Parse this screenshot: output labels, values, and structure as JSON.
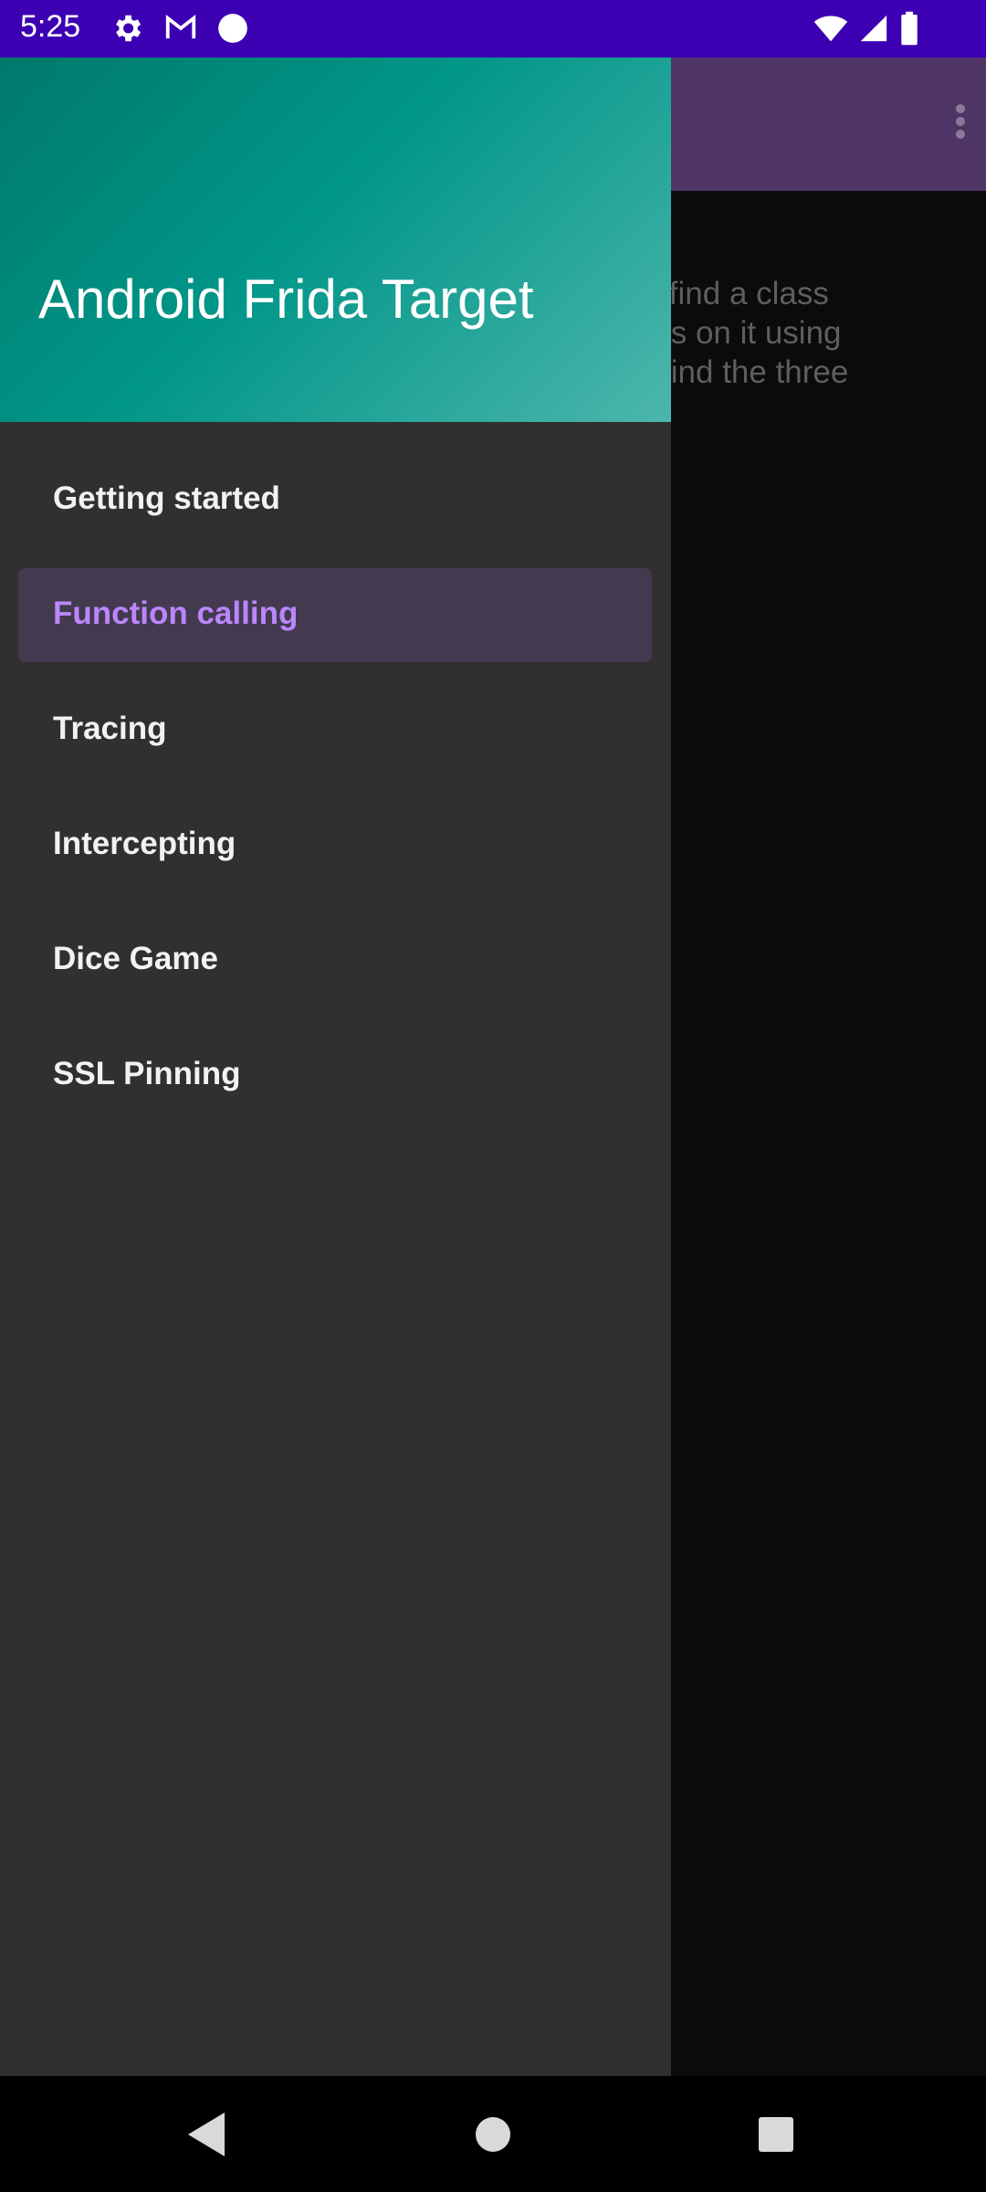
{
  "status_bar": {
    "time": "5:25",
    "left_icons": [
      "gear-icon",
      "gmail-icon",
      "circle-notification-icon"
    ],
    "right_icons": [
      "wifi-icon",
      "cell-signal-icon",
      "battery-icon"
    ],
    "background_color": "#3c00b2"
  },
  "app": {
    "toolbar_color": "#4e3566",
    "content_text": "an you find a class\nmethods on it using\nage to find the three"
  },
  "drawer": {
    "title": "Android Frida Target",
    "items": [
      {
        "label": "Getting started",
        "active": false
      },
      {
        "label": "Function calling",
        "active": true
      },
      {
        "label": "Tracing",
        "active": false
      },
      {
        "label": "Intercepting",
        "active": false
      },
      {
        "label": "Dice Game",
        "active": false
      },
      {
        "label": "SSL Pinning",
        "active": false
      }
    ],
    "accent_color": "#bb86fc",
    "header_gradient": [
      "#00796b",
      "#4db6ac"
    ]
  },
  "nav_bar": {
    "buttons": [
      "back-icon",
      "home-icon",
      "recents-icon"
    ]
  }
}
